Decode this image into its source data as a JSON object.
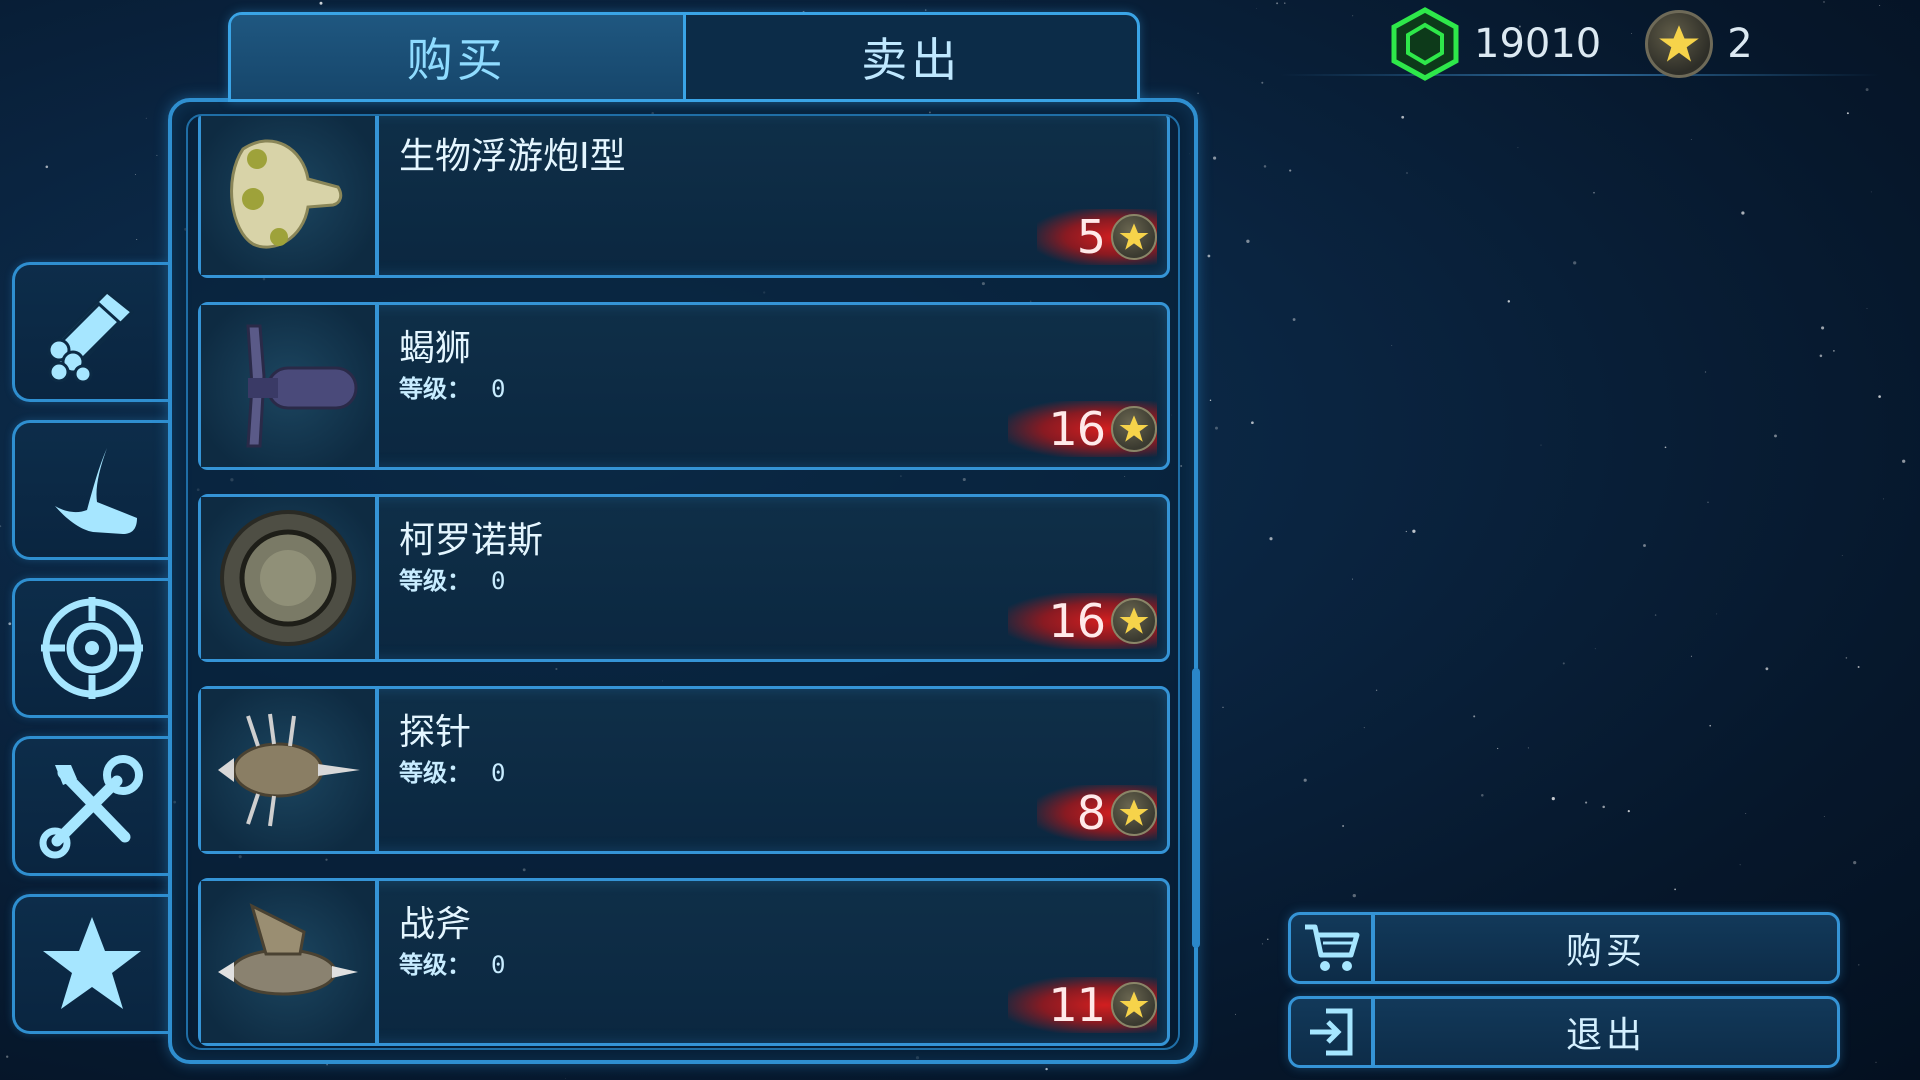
{
  "tabs": {
    "buy": "购买",
    "sell": "卖出",
    "active": "buy"
  },
  "currency": {
    "credits": "19010",
    "credits_icon": "hex-crystal-icon",
    "stars": "2",
    "stars_icon": "star-coin-icon"
  },
  "sidebar": [
    {
      "name": "sidebar-materials",
      "icon": "pipes-bundle-icon"
    },
    {
      "name": "sidebar-ships",
      "icon": "hull-icon"
    },
    {
      "name": "sidebar-weapons",
      "icon": "crosshair-icon"
    },
    {
      "name": "sidebar-tools",
      "icon": "wrench-screwdriver-icon"
    },
    {
      "name": "sidebar-favorites",
      "icon": "star-icon"
    }
  ],
  "items": [
    {
      "name": "生物浮游炮I型",
      "level_label": "",
      "level": "",
      "price": "5",
      "thumb": "bio-turret"
    },
    {
      "name": "蝎狮",
      "level_label": "等级：",
      "level": "0",
      "price": "16",
      "thumb": "scorpion"
    },
    {
      "name": "柯罗诺斯",
      "level_label": "等级：",
      "level": "0",
      "price": "16",
      "thumb": "disc"
    },
    {
      "name": "探针",
      "level_label": "等级：",
      "level": "0",
      "price": "8",
      "thumb": "probe"
    },
    {
      "name": "战斧",
      "level_label": "等级：",
      "level": "0",
      "price": "11",
      "thumb": "axe"
    }
  ],
  "actions": {
    "buy_label": "购买",
    "buy_icon": "cart-icon",
    "exit_label": "退出",
    "exit_icon": "exit-icon"
  },
  "colors": {
    "accent": "#3594d6",
    "price_red": "#d01e1e",
    "credits_green": "#2ee84a",
    "star_gold": "#f6d34a"
  }
}
